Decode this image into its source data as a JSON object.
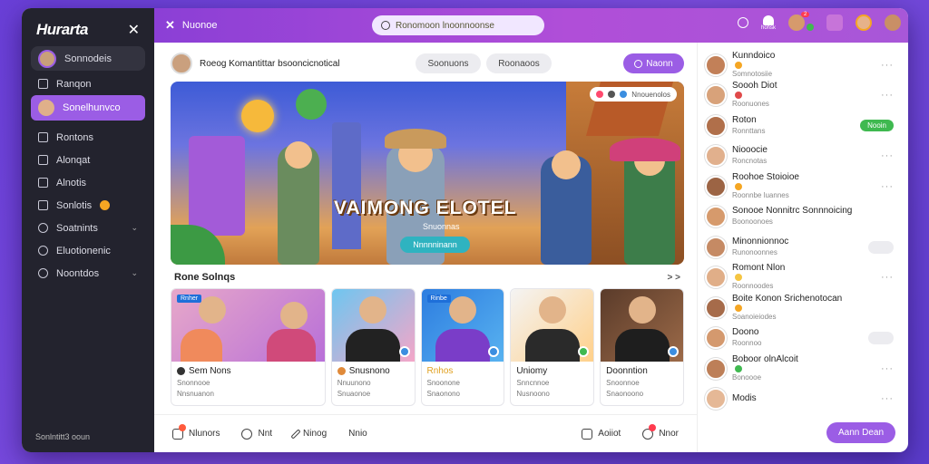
{
  "sidebar": {
    "logo": "Hurarta",
    "items": [
      {
        "label": "Sonnodeis",
        "kind": "profile"
      },
      {
        "label": "Ranqon",
        "kind": "icon"
      },
      {
        "label": "Sonelhunvco",
        "kind": "active"
      },
      {
        "label": "Rontons",
        "kind": "icon"
      },
      {
        "label": "Alonqat",
        "kind": "icon"
      },
      {
        "label": "Alnotis",
        "kind": "icon"
      },
      {
        "label": "Sonlotis",
        "kind": "emoji"
      },
      {
        "label": "Soatnints",
        "kind": "chevron"
      },
      {
        "label": "Eluotionenic",
        "kind": "icon"
      },
      {
        "label": "Noontdos",
        "kind": "chevron"
      }
    ],
    "footer": "Sonlntitt3 ooun"
  },
  "topbar": {
    "brand": "Nuonoe",
    "search_placeholder": "Ronomoon lnoonnoonse",
    "notif_count": "2",
    "stack_label": "hohsk"
  },
  "header": {
    "title": "Roeog Komantittar bsooncicnotical",
    "pill1": "Soonuons",
    "pill2": "Roonaoos",
    "cta": "Naonn"
  },
  "hero": {
    "game_title": "VAIMONG ELOTEL",
    "subline": "Snuonnas",
    "play_button": "Nnnnninann",
    "tag": "Nnouenolos"
  },
  "section": {
    "title": "Rone Solnqs",
    "more": "> >"
  },
  "cards": [
    {
      "thumb_label": "Rnher",
      "title": "Sem Nons",
      "meta1": "Snonnooe",
      "meta2": "Nnsnuanon"
    },
    {
      "thumb_label": "",
      "title": "Snusnono",
      "meta1": "Nnuunono",
      "meta2": "Snuaonoe"
    },
    {
      "thumb_label": "Rinbe",
      "title": "Rnhos",
      "meta1": "Snoonone",
      "meta2": "Snaonono"
    },
    {
      "thumb_label": "",
      "title": "Uniomy",
      "meta1": "Snncnnoe",
      "meta2": "Nusnoono"
    },
    {
      "thumb_label": "",
      "title": "Doonntion",
      "meta1": "Snoonnoe",
      "meta2": "Snaonoono"
    }
  ],
  "bottombar": {
    "items": [
      "Nlunors",
      "Nnt",
      "Ninog",
      "Nnio"
    ],
    "right_items": [
      "Aoiiot",
      "Nnor"
    ]
  },
  "right_panel": {
    "messages": [
      {
        "name": "Kunndoico",
        "sub": "Somnotosiie",
        "action": "dots"
      },
      {
        "name": "Soooh Diot",
        "sub": "Roonuones",
        "action": "dots"
      },
      {
        "name": "Roton",
        "sub": "Ronnttans",
        "action": "green",
        "chip": "Nooin"
      },
      {
        "name": "Niooocie",
        "sub": "Roncnotas",
        "action": "dots"
      },
      {
        "name": "Roohoe Stoioioe",
        "sub": "Roonnbe luannes",
        "action": "dots"
      },
      {
        "name": "Sonooe Nonnitrc Sonnnoicing",
        "sub": "Boonoonoes",
        "action": "none"
      },
      {
        "name": "Minonnionnoc",
        "sub": "Runonoonnes",
        "action": "grey"
      },
      {
        "name": "Romont Nlon",
        "sub": "Roonnoodes",
        "action": "dots"
      },
      {
        "name": "Boite Konon Srichenotocan",
        "sub": "Soanoieiodes",
        "action": "none"
      },
      {
        "name": "Doono",
        "sub": "Roonnoo",
        "action": "grey"
      },
      {
        "name": "Boboor olnAlcoit",
        "sub": "Bonoooe",
        "action": "dots"
      },
      {
        "name": "Modis",
        "sub": "",
        "action": "dots"
      }
    ],
    "cta": "Aann Dean"
  }
}
